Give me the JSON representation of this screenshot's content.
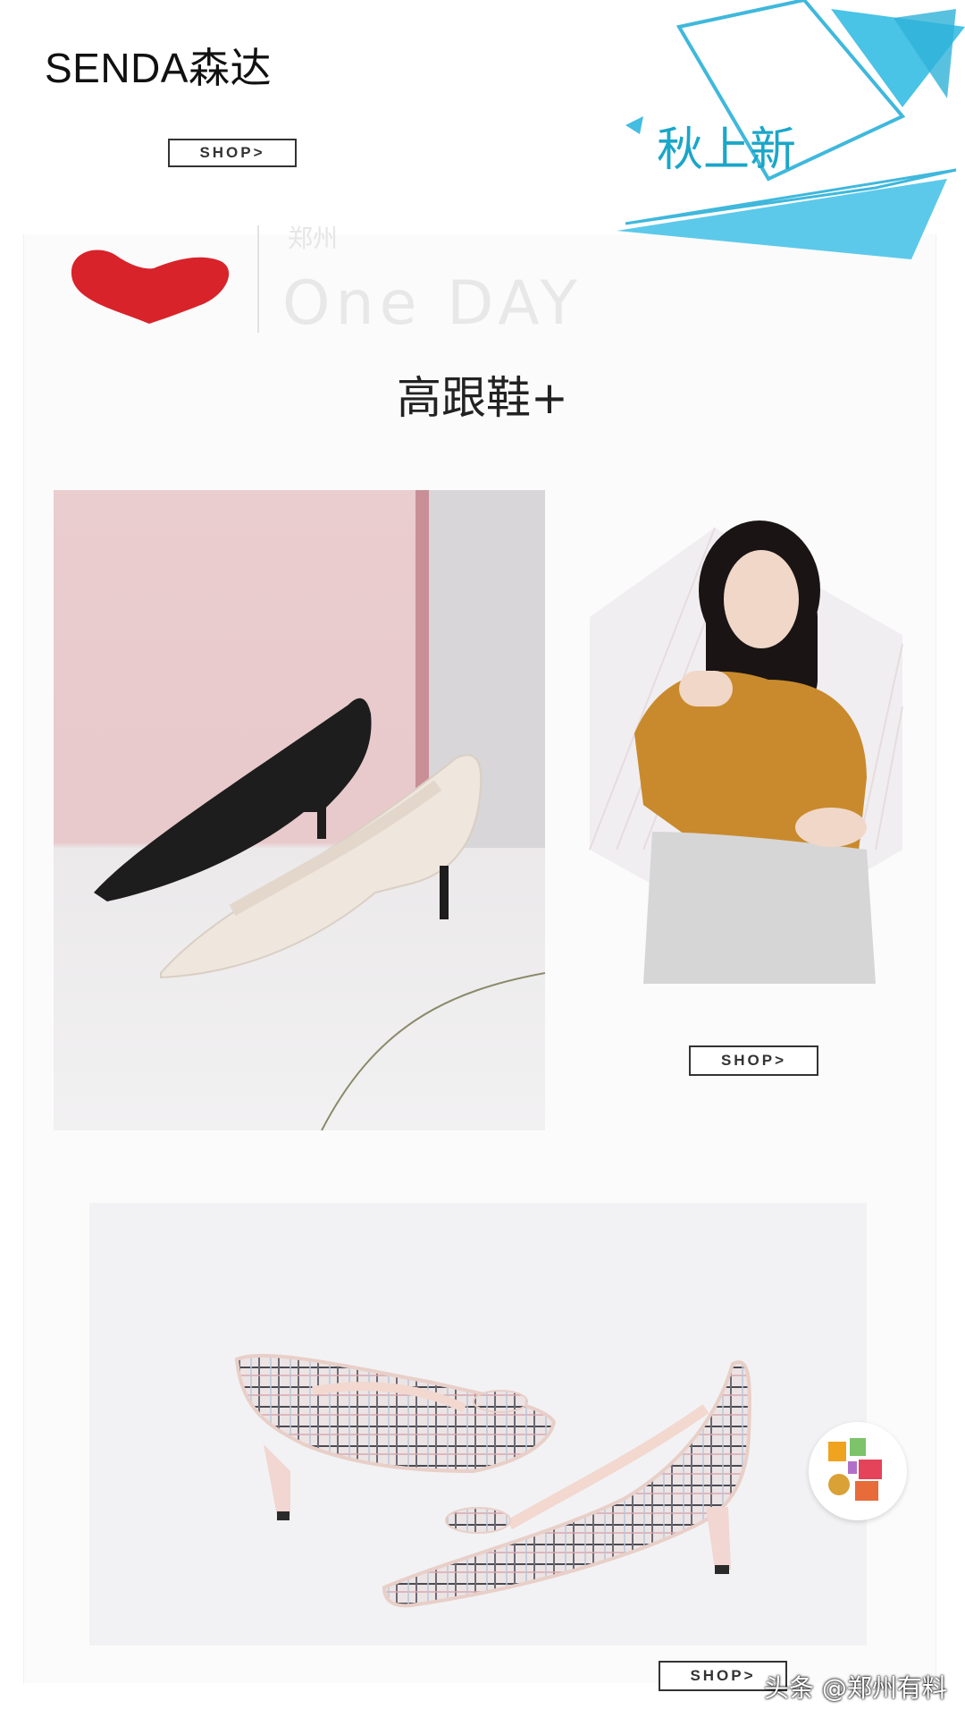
{
  "header": {
    "brand": "SENDA森达"
  },
  "badge": {
    "text": "秋上新"
  },
  "decor": {
    "oneday_small": "郑州",
    "oneday": "One DAY"
  },
  "section": {
    "title": "高跟鞋+"
  },
  "buttons": {
    "shop_1": "SHOP>",
    "shop_2": "SHOP>",
    "shop_3": "SHOP>"
  },
  "watermark": {
    "text": "头条 @郑州有料"
  },
  "colors": {
    "accent_cyan": "#1aa6c9",
    "heart_red": "#d8232a"
  }
}
